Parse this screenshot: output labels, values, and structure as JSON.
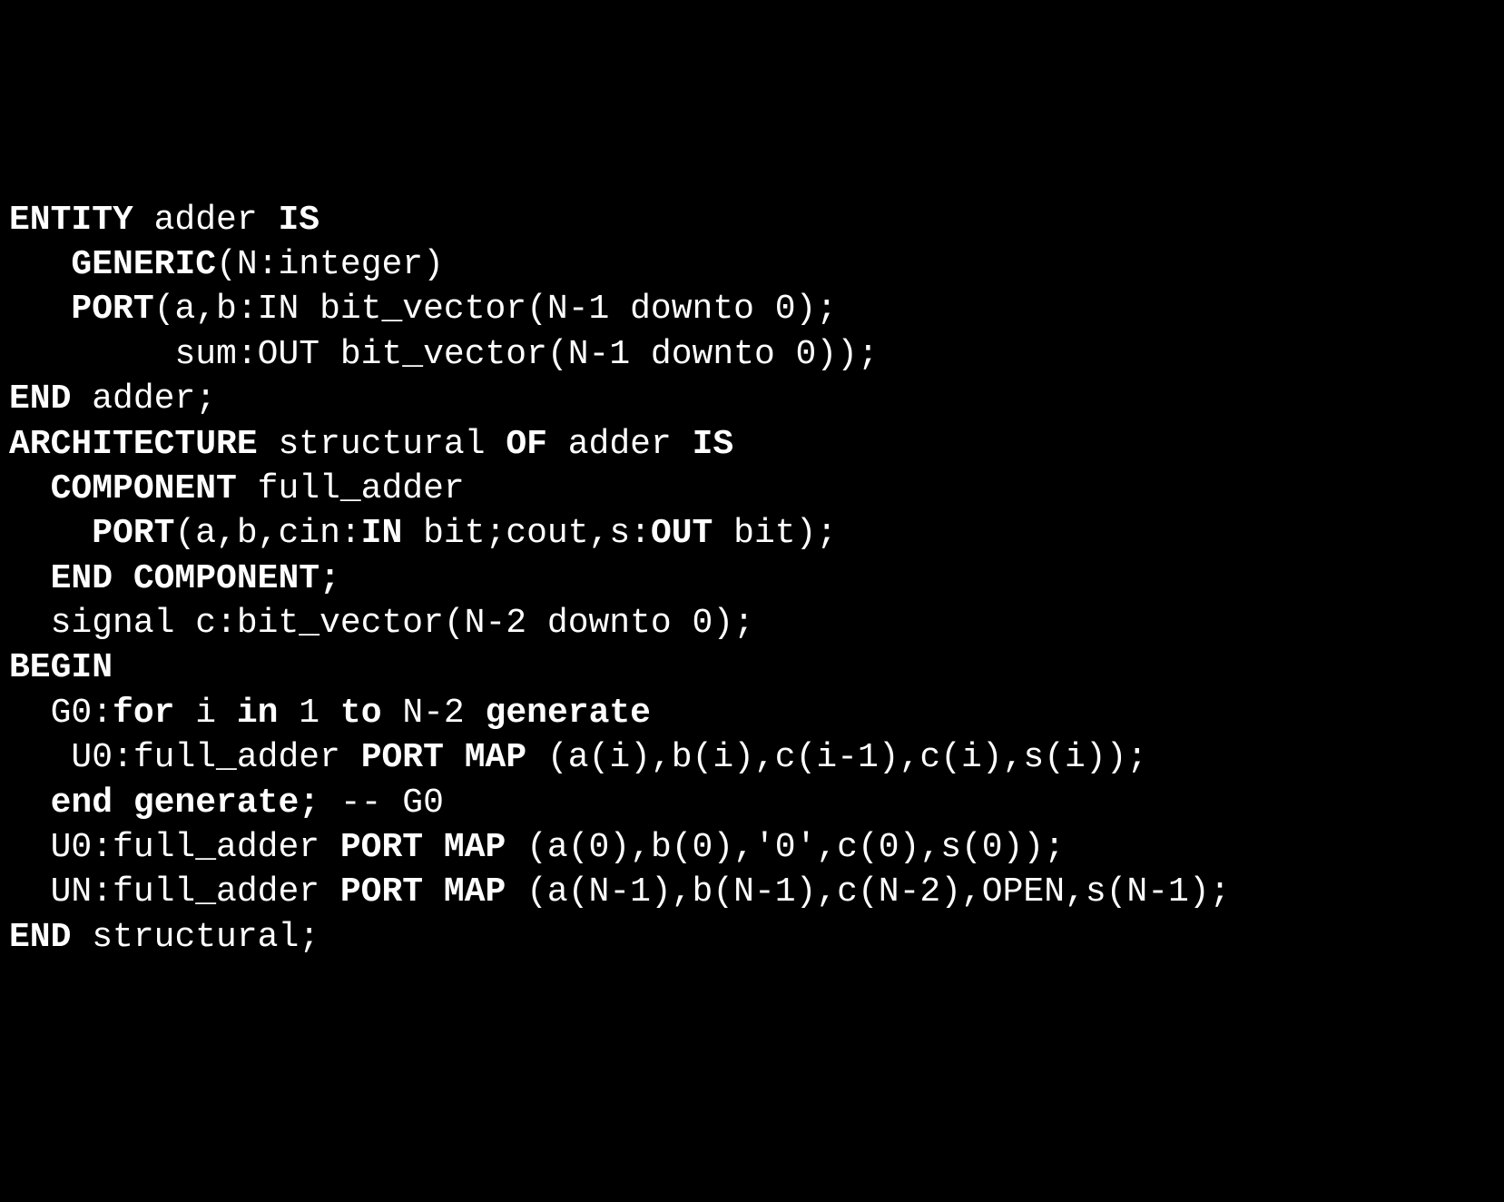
{
  "code": {
    "lines": [
      {
        "indent": 0,
        "tokens": [
          {
            "t": "ENTITY",
            "kw": true
          },
          {
            "t": " adder ",
            "kw": false
          },
          {
            "t": "IS",
            "kw": true
          }
        ]
      },
      {
        "indent": 3,
        "tokens": [
          {
            "t": "GENERIC",
            "kw": true
          },
          {
            "t": "(N:integer)",
            "kw": false
          }
        ]
      },
      {
        "indent": 3,
        "tokens": [
          {
            "t": "PORT",
            "kw": true
          },
          {
            "t": "(a,b:IN bit_vector(N-1 downto 0);",
            "kw": false
          }
        ]
      },
      {
        "indent": 8,
        "tokens": [
          {
            "t": "sum:OUT bit_vector(N-1 downto 0));",
            "kw": false
          }
        ]
      },
      {
        "indent": 0,
        "tokens": [
          {
            "t": "END",
            "kw": true
          },
          {
            "t": " adder;",
            "kw": false
          }
        ]
      },
      {
        "indent": 0,
        "tokens": [
          {
            "t": "ARCHITECTURE",
            "kw": true
          },
          {
            "t": " structural ",
            "kw": false
          },
          {
            "t": "OF",
            "kw": true
          },
          {
            "t": " adder ",
            "kw": false
          },
          {
            "t": "IS",
            "kw": true
          }
        ]
      },
      {
        "indent": 2,
        "tokens": [
          {
            "t": "COMPONENT",
            "kw": true
          },
          {
            "t": " full_adder",
            "kw": false
          }
        ]
      },
      {
        "indent": 4,
        "tokens": [
          {
            "t": "PORT",
            "kw": true
          },
          {
            "t": "(a,b,cin:",
            "kw": false
          },
          {
            "t": "IN",
            "kw": true
          },
          {
            "t": " bit;cout,s:",
            "kw": false
          },
          {
            "t": "OUT",
            "kw": true
          },
          {
            "t": " bit);",
            "kw": false
          }
        ]
      },
      {
        "indent": 2,
        "tokens": [
          {
            "t": "END COMPONENT;",
            "kw": true
          }
        ]
      },
      {
        "indent": 2,
        "tokens": [
          {
            "t": "signal c:bit_vector(N-2 downto 0);",
            "kw": false
          }
        ]
      },
      {
        "indent": 0,
        "tokens": [
          {
            "t": "BEGIN",
            "kw": true
          }
        ]
      },
      {
        "indent": 2,
        "tokens": [
          {
            "t": "G0:",
            "kw": false
          },
          {
            "t": "for",
            "kw": true
          },
          {
            "t": " i ",
            "kw": false
          },
          {
            "t": "in",
            "kw": true
          },
          {
            "t": " 1 ",
            "kw": false
          },
          {
            "t": "to",
            "kw": true
          },
          {
            "t": " N-2 ",
            "kw": false
          },
          {
            "t": "generate",
            "kw": true
          }
        ]
      },
      {
        "indent": 3,
        "tokens": [
          {
            "t": "U0:full_adder ",
            "kw": false
          },
          {
            "t": "PORT MAP",
            "kw": true
          },
          {
            "t": " (a(i),b(i),c(i-1),c(i),s(i));",
            "kw": false
          }
        ]
      },
      {
        "indent": 2,
        "tokens": [
          {
            "t": "end generate;",
            "kw": true
          },
          {
            "t": " -- G0",
            "kw": false
          }
        ]
      },
      {
        "indent": 2,
        "tokens": [
          {
            "t": "U0:full_adder ",
            "kw": false
          },
          {
            "t": "PORT MAP",
            "kw": true
          },
          {
            "t": " (a(0),b(0),'0',c(0),s(0));",
            "kw": false
          }
        ]
      },
      {
        "indent": 2,
        "tokens": [
          {
            "t": "UN:full_adder ",
            "kw": false
          },
          {
            "t": "PORT MAP",
            "kw": true
          },
          {
            "t": " (a(N-1),b(N-1),c(N-2),OPEN,s(N-1);",
            "kw": false
          }
        ]
      },
      {
        "indent": 0,
        "tokens": [
          {
            "t": "END",
            "kw": true
          },
          {
            "t": " structural;",
            "kw": false
          }
        ]
      }
    ]
  }
}
